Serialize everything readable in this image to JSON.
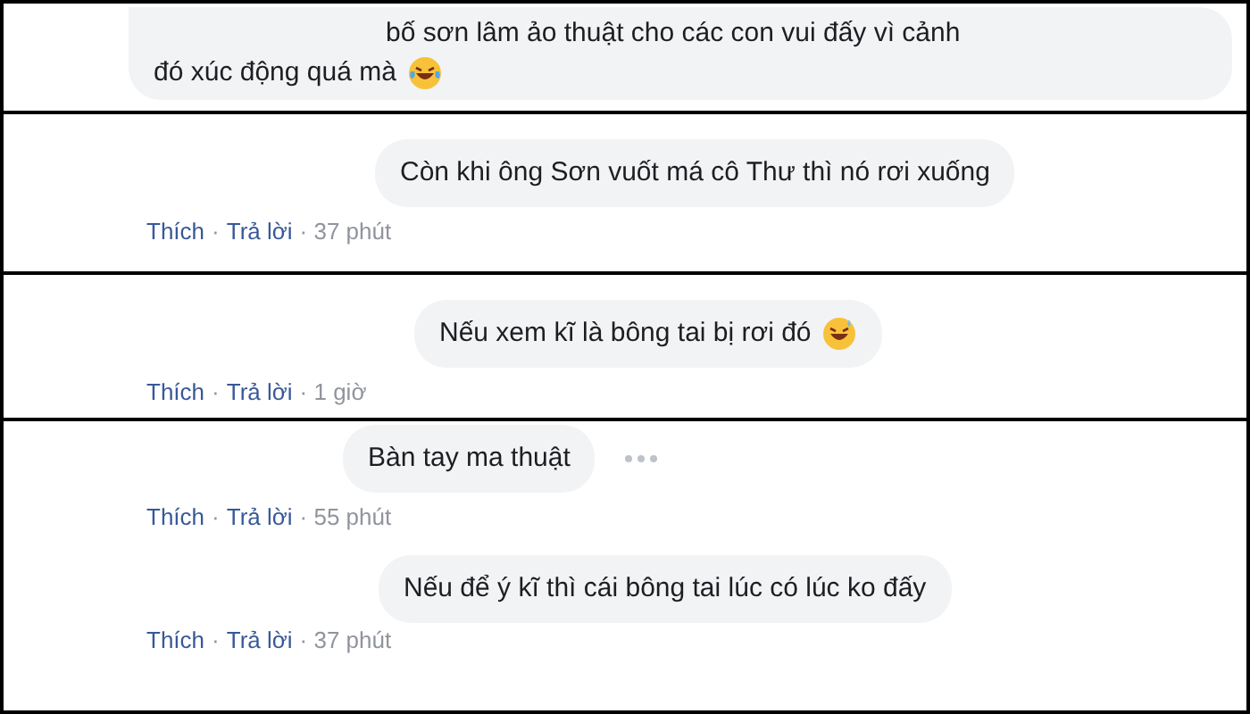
{
  "panels": [
    {
      "comments": [
        {
          "lines": [
            "bố sơn lâm ảo thuật cho các con vui đấy vì cảnh",
            "đó xúc động quá mà"
          ],
          "emoji": {
            "kind": "tears"
          },
          "more": false
        }
      ]
    },
    {
      "comments": [
        {
          "text": "Còn khi ông Sơn vuốt má cô Thư thì nó rơi xuống",
          "more": false,
          "actions": [
            {
              "kind": "link",
              "text": "Thích"
            },
            {
              "kind": "sep",
              "text": "·"
            },
            {
              "kind": "link",
              "text": "Trả lời"
            },
            {
              "kind": "time",
              "text": "· 37 phút"
            }
          ]
        }
      ]
    },
    {
      "comments": [
        {
          "text": "Nếu xem kĩ là bông tai bị rơi đó",
          "emoji": {
            "kind": "sweat"
          },
          "more": false,
          "actions": [
            {
              "kind": "link",
              "text": "Thích"
            },
            {
              "kind": "sep",
              "text": "·"
            },
            {
              "kind": "link",
              "text": "Trả lời"
            },
            {
              "kind": "time",
              "text": "· 1 giờ"
            }
          ]
        }
      ]
    },
    {
      "comments": [
        {
          "text": "Bàn tay ma thuật",
          "more": true,
          "actions": [
            {
              "kind": "link",
              "text": "Thích"
            },
            {
              "kind": "sep",
              "text": "·"
            },
            {
              "kind": "link",
              "text": "Trả lời"
            },
            {
              "kind": "time",
              "text": "· 55 phút"
            }
          ]
        },
        {
          "text": "Nếu để ý kĩ thì cái bông tai lúc có lúc ko đấy",
          "more": false,
          "actions": [
            {
              "kind": "link",
              "text": "Thích"
            },
            {
              "kind": "sep",
              "text": "·"
            },
            {
              "kind": "link",
              "text": "Trả lời"
            },
            {
              "kind": "time",
              "text": "· 37 phút"
            }
          ]
        }
      ]
    }
  ]
}
